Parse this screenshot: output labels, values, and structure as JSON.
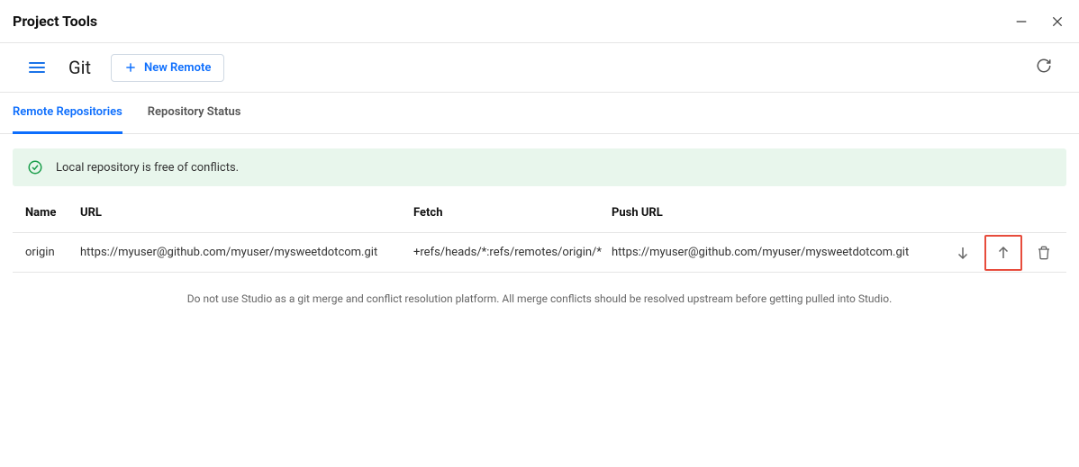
{
  "window": {
    "title": "Project Tools"
  },
  "toolbar": {
    "heading": "Git",
    "new_remote_label": "New Remote"
  },
  "tabs": [
    {
      "label": "Remote Repositories",
      "active": true
    },
    {
      "label": "Repository Status",
      "active": false
    }
  ],
  "banner": {
    "message": "Local repository is free of conflicts."
  },
  "table": {
    "headers": {
      "name": "Name",
      "url": "URL",
      "fetch": "Fetch",
      "push": "Push URL"
    },
    "rows": [
      {
        "name": "origin",
        "url": "https://myuser@github.com/myuser/mysweetdotcom.git",
        "fetch": "+refs/heads/*:refs/remotes/origin/*",
        "push": "https://myuser@github.com/myuser/mysweetdotcom.git"
      }
    ]
  },
  "footer": {
    "note": "Do not use Studio as a git merge and conflict resolution platform. All merge conflicts should be resolved upstream before getting pulled into Studio."
  }
}
